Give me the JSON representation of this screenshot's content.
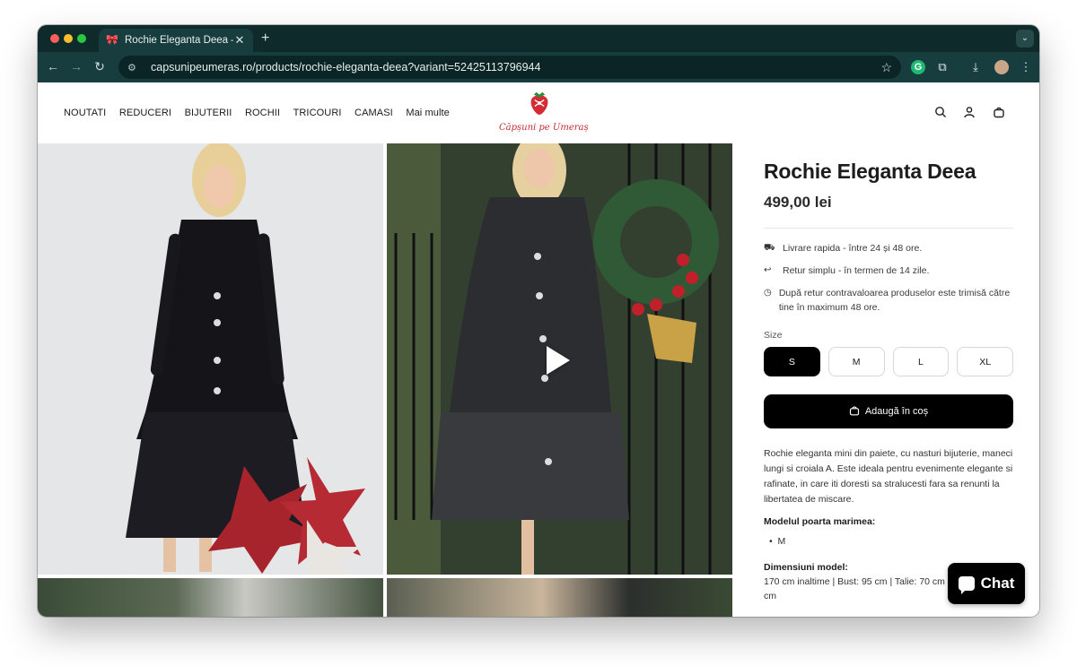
{
  "browser": {
    "tab_title": "Rochie Eleganta Deea – Caps",
    "tab_close": "✕",
    "new_tab": "+",
    "url": "capsunipeumeras.ro/products/rochie-eleganta-deea?variant=52425113796944",
    "icons": [
      "back-icon",
      "forward-icon",
      "reload-icon",
      "site-info-icon",
      "star-icon",
      "grammarly-icon",
      "extensions-icon",
      "download-icon",
      "profile-avatar",
      "more-icon"
    ]
  },
  "nav": {
    "items": [
      "NOUTATI",
      "REDUCERI",
      "BIJUTERII",
      "ROCHII",
      "TRICOURI",
      "CAMASI",
      "Mai multe"
    ]
  },
  "logo": {
    "text": "Căpșuni pe Umeraș"
  },
  "product": {
    "title": "Rochie Eleganta Deea",
    "price": "499,00 lei",
    "perks": [
      {
        "icon": "truck-icon",
        "text": "Livrare rapida - între 24 și 48 ore."
      },
      {
        "icon": "return-icon",
        "text": "Retur simplu - în termen de 14 zile."
      },
      {
        "icon": "clock-icon",
        "text": "După retur contravaloarea produselor este trimisă către tine în maximum 48 ore."
      }
    ],
    "size_label": "Size",
    "sizes": [
      "S",
      "M",
      "L",
      "XL"
    ],
    "selected_size": "S",
    "add_to_cart": "Adaugă în coș",
    "description": "Rochie eleganta mini din paiete, cu nasturi bijuterie, maneci lungi si croiala A. Este ideala pentru evenimente elegante si rafinate, in care iti doresti sa stralucesti fara sa renunti la libertatea de miscare.",
    "model_size_heading": "Modelul poarta marimea:",
    "model_size": "M",
    "dimensions_heading": "Dimensiuni model:",
    "dimensions": "170 cm inaltime | Bust: 95 cm | Talie: 70 cm | Coapse: 95 cm"
  },
  "chat": {
    "label": "Chat"
  }
}
